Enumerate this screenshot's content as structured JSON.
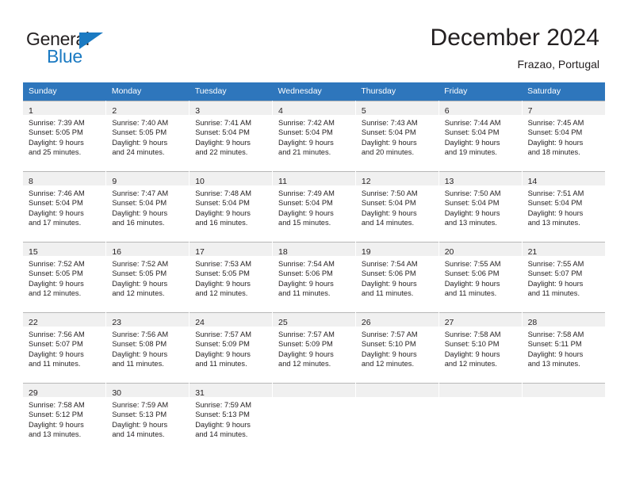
{
  "brand": {
    "name_top": "General",
    "name_bottom": "Blue",
    "accent_color": "#1b7ac2",
    "triangle_icon": "brand-triangle-icon"
  },
  "header": {
    "title": "December 2024",
    "subtitle": "Frazao, Portugal"
  },
  "calendar": {
    "header_bg": "#2e76bc",
    "header_text_color": "#ffffff",
    "daynum_band_bg": "#f0f0f0",
    "grid_line_color": "#b7b7b7",
    "weekdays": [
      "Sunday",
      "Monday",
      "Tuesday",
      "Wednesday",
      "Thursday",
      "Friday",
      "Saturday"
    ],
    "weeks": [
      [
        {
          "day": "1",
          "lines": [
            "Sunrise: 7:39 AM",
            "Sunset: 5:05 PM",
            "Daylight: 9 hours",
            "and 25 minutes."
          ]
        },
        {
          "day": "2",
          "lines": [
            "Sunrise: 7:40 AM",
            "Sunset: 5:05 PM",
            "Daylight: 9 hours",
            "and 24 minutes."
          ]
        },
        {
          "day": "3",
          "lines": [
            "Sunrise: 7:41 AM",
            "Sunset: 5:04 PM",
            "Daylight: 9 hours",
            "and 22 minutes."
          ]
        },
        {
          "day": "4",
          "lines": [
            "Sunrise: 7:42 AM",
            "Sunset: 5:04 PM",
            "Daylight: 9 hours",
            "and 21 minutes."
          ]
        },
        {
          "day": "5",
          "lines": [
            "Sunrise: 7:43 AM",
            "Sunset: 5:04 PM",
            "Daylight: 9 hours",
            "and 20 minutes."
          ]
        },
        {
          "day": "6",
          "lines": [
            "Sunrise: 7:44 AM",
            "Sunset: 5:04 PM",
            "Daylight: 9 hours",
            "and 19 minutes."
          ]
        },
        {
          "day": "7",
          "lines": [
            "Sunrise: 7:45 AM",
            "Sunset: 5:04 PM",
            "Daylight: 9 hours",
            "and 18 minutes."
          ]
        }
      ],
      [
        {
          "day": "8",
          "lines": [
            "Sunrise: 7:46 AM",
            "Sunset: 5:04 PM",
            "Daylight: 9 hours",
            "and 17 minutes."
          ]
        },
        {
          "day": "9",
          "lines": [
            "Sunrise: 7:47 AM",
            "Sunset: 5:04 PM",
            "Daylight: 9 hours",
            "and 16 minutes."
          ]
        },
        {
          "day": "10",
          "lines": [
            "Sunrise: 7:48 AM",
            "Sunset: 5:04 PM",
            "Daylight: 9 hours",
            "and 16 minutes."
          ]
        },
        {
          "day": "11",
          "lines": [
            "Sunrise: 7:49 AM",
            "Sunset: 5:04 PM",
            "Daylight: 9 hours",
            "and 15 minutes."
          ]
        },
        {
          "day": "12",
          "lines": [
            "Sunrise: 7:50 AM",
            "Sunset: 5:04 PM",
            "Daylight: 9 hours",
            "and 14 minutes."
          ]
        },
        {
          "day": "13",
          "lines": [
            "Sunrise: 7:50 AM",
            "Sunset: 5:04 PM",
            "Daylight: 9 hours",
            "and 13 minutes."
          ]
        },
        {
          "day": "14",
          "lines": [
            "Sunrise: 7:51 AM",
            "Sunset: 5:04 PM",
            "Daylight: 9 hours",
            "and 13 minutes."
          ]
        }
      ],
      [
        {
          "day": "15",
          "lines": [
            "Sunrise: 7:52 AM",
            "Sunset: 5:05 PM",
            "Daylight: 9 hours",
            "and 12 minutes."
          ]
        },
        {
          "day": "16",
          "lines": [
            "Sunrise: 7:52 AM",
            "Sunset: 5:05 PM",
            "Daylight: 9 hours",
            "and 12 minutes."
          ]
        },
        {
          "day": "17",
          "lines": [
            "Sunrise: 7:53 AM",
            "Sunset: 5:05 PM",
            "Daylight: 9 hours",
            "and 12 minutes."
          ]
        },
        {
          "day": "18",
          "lines": [
            "Sunrise: 7:54 AM",
            "Sunset: 5:06 PM",
            "Daylight: 9 hours",
            "and 11 minutes."
          ]
        },
        {
          "day": "19",
          "lines": [
            "Sunrise: 7:54 AM",
            "Sunset: 5:06 PM",
            "Daylight: 9 hours",
            "and 11 minutes."
          ]
        },
        {
          "day": "20",
          "lines": [
            "Sunrise: 7:55 AM",
            "Sunset: 5:06 PM",
            "Daylight: 9 hours",
            "and 11 minutes."
          ]
        },
        {
          "day": "21",
          "lines": [
            "Sunrise: 7:55 AM",
            "Sunset: 5:07 PM",
            "Daylight: 9 hours",
            "and 11 minutes."
          ]
        }
      ],
      [
        {
          "day": "22",
          "lines": [
            "Sunrise: 7:56 AM",
            "Sunset: 5:07 PM",
            "Daylight: 9 hours",
            "and 11 minutes."
          ]
        },
        {
          "day": "23",
          "lines": [
            "Sunrise: 7:56 AM",
            "Sunset: 5:08 PM",
            "Daylight: 9 hours",
            "and 11 minutes."
          ]
        },
        {
          "day": "24",
          "lines": [
            "Sunrise: 7:57 AM",
            "Sunset: 5:09 PM",
            "Daylight: 9 hours",
            "and 11 minutes."
          ]
        },
        {
          "day": "25",
          "lines": [
            "Sunrise: 7:57 AM",
            "Sunset: 5:09 PM",
            "Daylight: 9 hours",
            "and 12 minutes."
          ]
        },
        {
          "day": "26",
          "lines": [
            "Sunrise: 7:57 AM",
            "Sunset: 5:10 PM",
            "Daylight: 9 hours",
            "and 12 minutes."
          ]
        },
        {
          "day": "27",
          "lines": [
            "Sunrise: 7:58 AM",
            "Sunset: 5:10 PM",
            "Daylight: 9 hours",
            "and 12 minutes."
          ]
        },
        {
          "day": "28",
          "lines": [
            "Sunrise: 7:58 AM",
            "Sunset: 5:11 PM",
            "Daylight: 9 hours",
            "and 13 minutes."
          ]
        }
      ],
      [
        {
          "day": "29",
          "lines": [
            "Sunrise: 7:58 AM",
            "Sunset: 5:12 PM",
            "Daylight: 9 hours",
            "and 13 minutes."
          ]
        },
        {
          "day": "30",
          "lines": [
            "Sunrise: 7:59 AM",
            "Sunset: 5:13 PM",
            "Daylight: 9 hours",
            "and 14 minutes."
          ]
        },
        {
          "day": "31",
          "lines": [
            "Sunrise: 7:59 AM",
            "Sunset: 5:13 PM",
            "Daylight: 9 hours",
            "and 14 minutes."
          ]
        },
        {
          "day": "",
          "lines": []
        },
        {
          "day": "",
          "lines": []
        },
        {
          "day": "",
          "lines": []
        },
        {
          "day": "",
          "lines": []
        }
      ]
    ]
  }
}
